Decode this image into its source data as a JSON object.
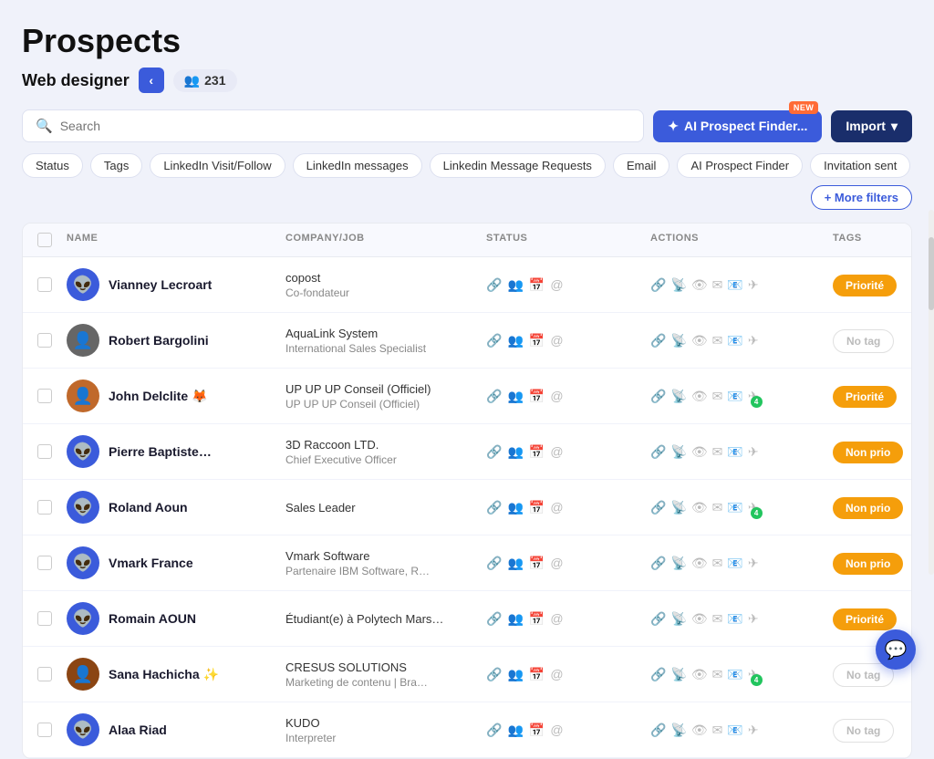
{
  "page": {
    "title": "Prospects",
    "subtitle": "Web designer",
    "count": "231",
    "back_label": "‹"
  },
  "search": {
    "placeholder": "Search"
  },
  "buttons": {
    "ai_finder": "AI Prospect Finder...",
    "ai_finder_badge": "NEW",
    "import": "Import",
    "more_filters": "+ More filters"
  },
  "filters": [
    "Status",
    "Tags",
    "LinkedIn Visit/Follow",
    "LinkedIn messages",
    "Linkedin Message Requests",
    "Email",
    "AI Prospect Finder",
    "Invitation sent"
  ],
  "table": {
    "headers": [
      "",
      "NAME",
      "COMPANY/JOB",
      "STATUS",
      "ACTIONS",
      "TAGS"
    ],
    "rows": [
      {
        "name": "Vianney Lecroart",
        "emoji": "",
        "company": "copost",
        "job": "Co-fondateur",
        "tag": "Priorité",
        "tag_type": "priorite",
        "avatar_color": "#3b5bdb",
        "avatar_icon": "👽",
        "link_orange": false,
        "action_badge": null
      },
      {
        "name": "Robert Bargolini",
        "emoji": "",
        "company": "AquaLink System",
        "job": "International Sales Specialist",
        "tag": "No tag",
        "tag_type": "no-tag",
        "avatar_color": "#666",
        "avatar_icon": "👤",
        "link_orange": false,
        "action_badge": null
      },
      {
        "name": "John Delclite",
        "emoji": "🦊",
        "company": "UP UP UP Conseil (Officiel)",
        "job": "UP UP UP Conseil (Officiel)",
        "tag": "Priorité",
        "tag_type": "priorite",
        "avatar_color": "#c0692b",
        "avatar_icon": "👤",
        "link_orange": false,
        "action_badge": "4"
      },
      {
        "name": "Pierre Baptiste…",
        "emoji": "",
        "company": "3D Raccoon LTD.",
        "job": "Chief Executive Officer",
        "tag": "Non prio",
        "tag_type": "non-prio",
        "avatar_color": "#3b5bdb",
        "avatar_icon": "👽",
        "link_orange": false,
        "action_badge": null
      },
      {
        "name": "Roland Aoun",
        "emoji": "",
        "company": "Sales Leader",
        "job": "",
        "tag": "Non prio",
        "tag_type": "non-prio",
        "avatar_color": "#3b5bdb",
        "avatar_icon": "👽",
        "link_orange": false,
        "action_badge": "4"
      },
      {
        "name": "Vmark France",
        "emoji": "",
        "company": "Vmark Software",
        "job": "Partenaire IBM Software, R…",
        "tag": "Non prio",
        "tag_type": "non-prio",
        "avatar_color": "#3b5bdb",
        "avatar_icon": "👽",
        "link_orange": true,
        "action_badge": null
      },
      {
        "name": "Romain AOUN",
        "emoji": "",
        "company": "Étudiant(e) à Polytech Mars…",
        "job": "",
        "tag": "Priorité",
        "tag_type": "priorite",
        "avatar_color": "#3b5bdb",
        "avatar_icon": "👽",
        "link_orange": false,
        "action_badge": null
      },
      {
        "name": "Sana Hachicha",
        "emoji": "✨",
        "company": "CRESUS SOLUTIONS",
        "job": "Marketing de contenu | Bra…",
        "tag": "No tag",
        "tag_type": "no-tag",
        "avatar_color": "#8b4513",
        "avatar_icon": "👤",
        "link_orange": false,
        "action_badge": "4"
      },
      {
        "name": "Alaa Riad",
        "emoji": "",
        "company": "KUDO",
        "job": "Interpreter",
        "tag": "No tag",
        "tag_type": "no-tag",
        "avatar_color": "#3b5bdb",
        "avatar_icon": "👽",
        "link_orange": true,
        "action_badge": null
      }
    ]
  },
  "chat_icon": "💬"
}
